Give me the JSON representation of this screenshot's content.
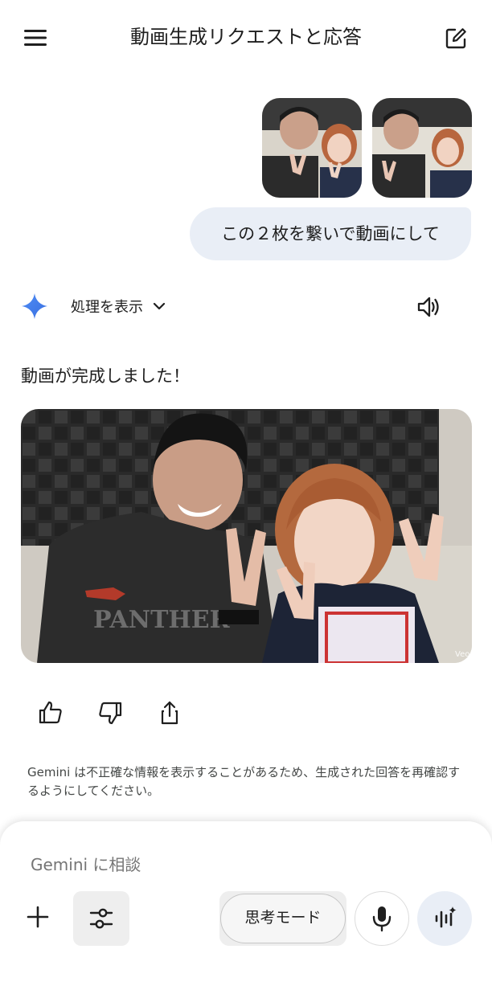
{
  "header": {
    "title": "動画生成リクエストと応答",
    "menu_icon": "hamburger-menu-icon",
    "edit_icon": "new-chat-edit-icon"
  },
  "user_message": {
    "images": [
      "photo-1",
      "photo-2"
    ],
    "text": "この２枚を繋いで動画にして"
  },
  "response": {
    "thinking_label": "処理を表示",
    "text": "動画が完成しました！",
    "video_watermark": "Veo",
    "shirt_text": "PANTHER"
  },
  "actions": {
    "icons": [
      "thumbs-up-icon",
      "thumbs-down-icon",
      "share-icon"
    ]
  },
  "disclaimer": "Gemini は不正確な情報を表示することがあるため、生成された回答を再確認するようにしてください。",
  "composer": {
    "placeholder": "Gemini に相談",
    "mode_label": "思考モード"
  },
  "colors": {
    "bubble": "#e9eef6",
    "accent": "#4285f4",
    "text": "#1f1f1f"
  }
}
